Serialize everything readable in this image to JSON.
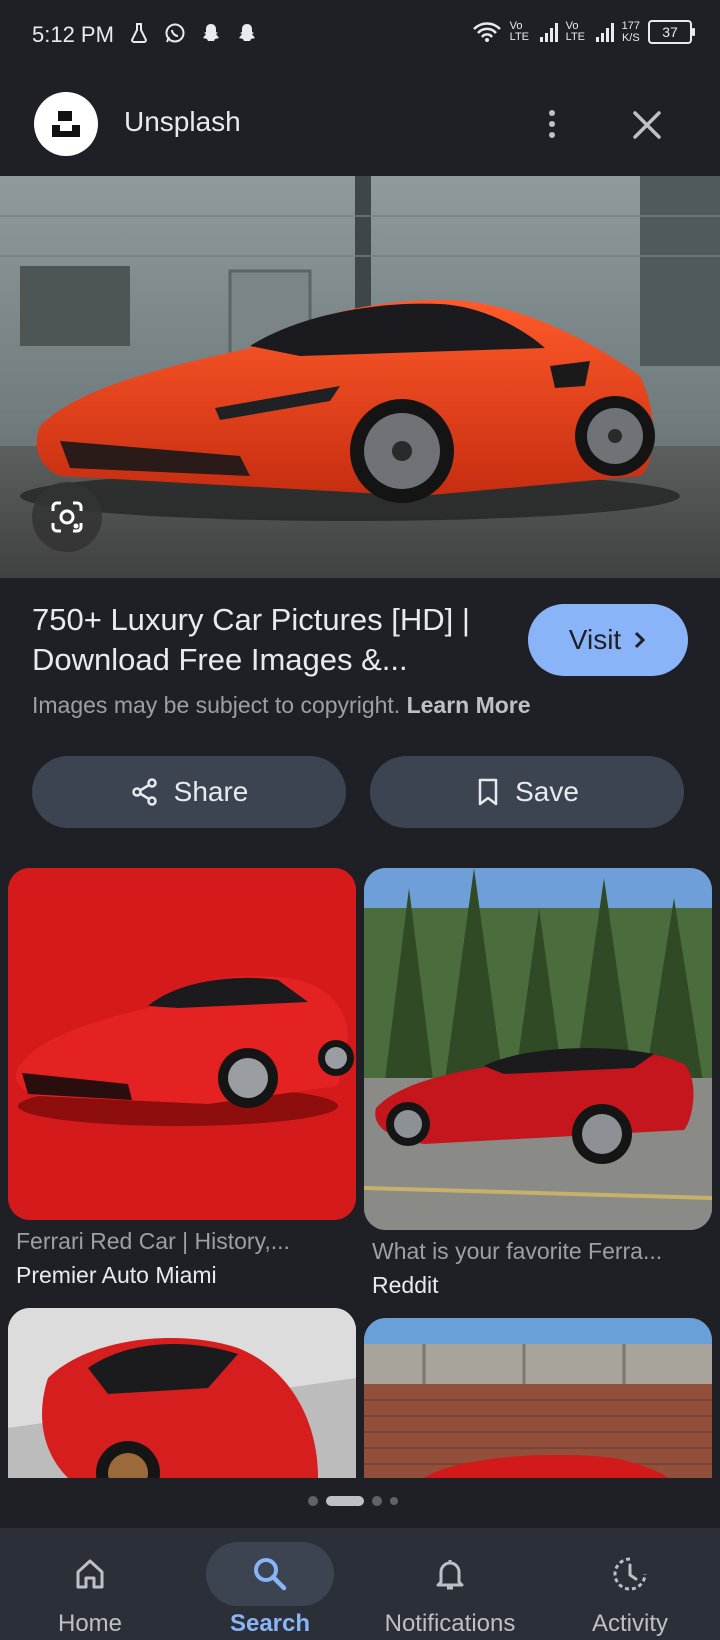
{
  "status_bar": {
    "time": "5:12 PM",
    "network_1": "Vo LTE",
    "network_2": "Vo LTE",
    "speed_value": "177",
    "speed_unit": "K/S",
    "battery": "37"
  },
  "header": {
    "site_name": "Unsplash",
    "logo_icon": "unsplash-logo",
    "more_icon": "more-vertical-icon",
    "close_icon": "close-icon"
  },
  "result": {
    "title": "750+ Luxury Car Pictures [HD] | Download Free Images &...",
    "visit_label": "Visit",
    "copyright_text": "Images may be subject to copyright.",
    "learn_more": "Learn More",
    "share_label": "Share",
    "save_label": "Save"
  },
  "related": [
    {
      "caption": "Ferrari Red Car | History,...",
      "source": "Premier Auto Miami"
    },
    {
      "caption": "What is your favorite Ferra...",
      "source": "Reddit"
    }
  ],
  "pagination": {
    "count": 4,
    "active": 1
  },
  "nav": {
    "items": [
      {
        "label": "Home",
        "icon": "home-icon"
      },
      {
        "label": "Search",
        "icon": "search-icon",
        "active": true
      },
      {
        "label": "Notifications",
        "icon": "bell-icon"
      },
      {
        "label": "Activity",
        "icon": "activity-icon"
      }
    ]
  },
  "colors": {
    "background": "#1f2026",
    "accent": "#8ab4f8",
    "pill": "#3c4452",
    "nav": "#2b2f38"
  }
}
